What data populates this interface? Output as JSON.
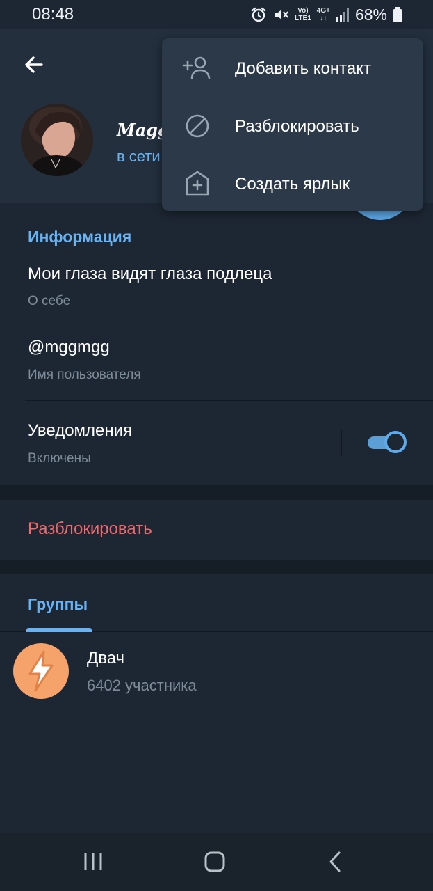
{
  "status_bar": {
    "time": "08:48",
    "network_top": "Vo)",
    "network_bottom": "LTE1",
    "signal_type": "4G+",
    "battery": "68%",
    "icons": [
      "alarm-icon",
      "mute-icon",
      "signal-icon",
      "battery-icon"
    ]
  },
  "profile": {
    "name": "Magg",
    "status": "в сети"
  },
  "menu": {
    "items": [
      {
        "label": "Добавить контакт",
        "icon": "add-contact-icon"
      },
      {
        "label": "Разблокировать",
        "icon": "block-icon"
      },
      {
        "label": "Создать ярлык",
        "icon": "shortcut-icon"
      }
    ]
  },
  "info": {
    "title": "Информация",
    "bio_value": "Мои глаза видят глаза подлеца",
    "bio_label": "О себе",
    "username_value": "@mggmgg",
    "username_label": "Имя пользователя",
    "notifications_label": "Уведомления",
    "notifications_state": "Включены",
    "notifications_on": true
  },
  "unblock_label": "Разблокировать",
  "groups": {
    "tab_label": "Группы",
    "items": [
      {
        "name": "Двач",
        "members": "6402 участника",
        "avatar_color": "#f5a26b"
      }
    ]
  },
  "colors": {
    "accent": "#6ab3f3",
    "danger": "#ec6b6f",
    "background": "#1d2733",
    "header": "#232f3d",
    "menu": "#2b3948"
  },
  "navbar": {
    "buttons": [
      "recent-apps-icon",
      "home-icon",
      "back-icon"
    ]
  }
}
